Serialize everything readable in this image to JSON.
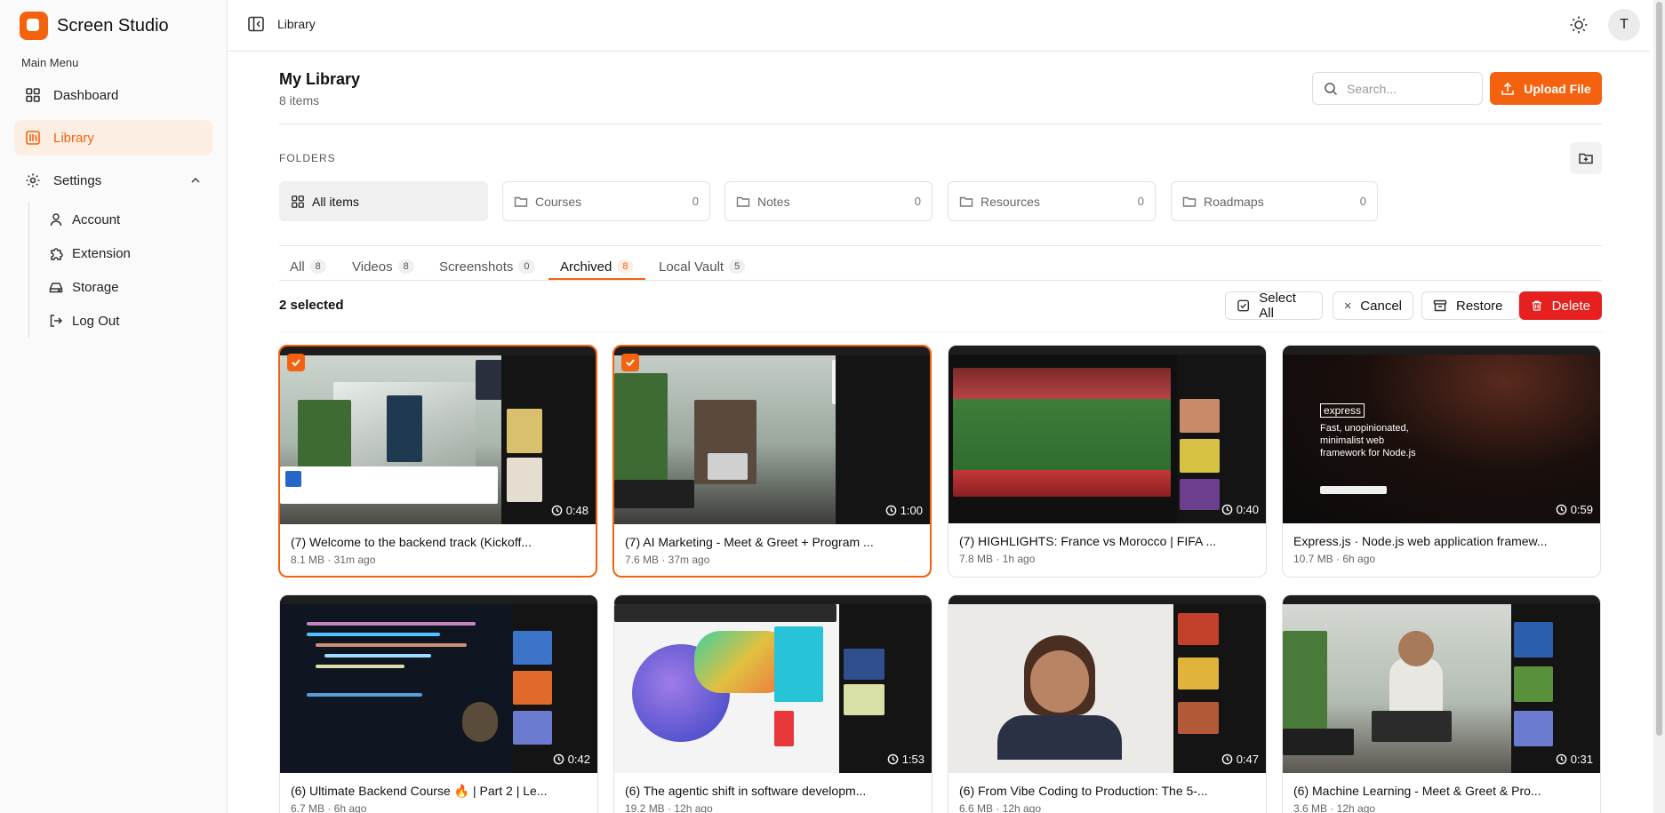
{
  "app": {
    "name": "Screen Studio"
  },
  "sidebar": {
    "menu_title": "Main Menu",
    "items": [
      {
        "label": "Dashboard",
        "icon": "grid-icon"
      },
      {
        "label": "Library",
        "icon": "library-icon",
        "active": true
      },
      {
        "label": "Settings",
        "icon": "gear-icon",
        "expanded": true
      }
    ],
    "sub_items": [
      {
        "label": "Account",
        "icon": "user-icon"
      },
      {
        "label": "Extension",
        "icon": "puzzle-icon"
      },
      {
        "label": "Storage",
        "icon": "drive-icon"
      },
      {
        "label": "Log Out",
        "icon": "logout-icon"
      }
    ]
  },
  "topbar": {
    "breadcrumb": "Library",
    "avatar_initial": "T"
  },
  "main": {
    "title": "My Library",
    "count": "8 items",
    "search": {
      "placeholder": "Search..."
    },
    "upload_label": "Upload File",
    "folders_title": "FOLDERS",
    "folders": [
      {
        "label": "All items",
        "count": ""
      },
      {
        "label": "Courses",
        "count": "0"
      },
      {
        "label": "Notes",
        "count": "0"
      },
      {
        "label": "Resources",
        "count": "0"
      },
      {
        "label": "Roadmaps",
        "count": "0"
      }
    ],
    "tabs": [
      {
        "label": "All",
        "count": "8"
      },
      {
        "label": "Videos",
        "count": "8"
      },
      {
        "label": "Screenshots",
        "count": "0"
      },
      {
        "label": "Archived",
        "count": "8",
        "active": true
      },
      {
        "label": "Local Vault",
        "count": "5"
      }
    ],
    "selection": {
      "text": "2 selected",
      "select_all": "Select All",
      "cancel": "Cancel",
      "restore": "Restore",
      "delete": "Delete"
    },
    "videos": [
      {
        "title": "(7) Welcome to the backend track (Kickoff...",
        "meta": "8.1 MB · 31m ago",
        "duration": "0:48",
        "selected": true
      },
      {
        "title": "(7) AI Marketing - Meet & Greet + Program ...",
        "meta": "7.6 MB · 37m ago",
        "duration": "1:00",
        "selected": true
      },
      {
        "title": "(7) HIGHLIGHTS: France vs Morocco | FIFA ...",
        "meta": "7.8 MB · 1h ago",
        "duration": "0:40",
        "selected": false
      },
      {
        "title": "Express.js · Node.js web application framew...",
        "meta": "10.7 MB · 6h ago",
        "duration": "0:59",
        "selected": false,
        "overlay_title": "express",
        "overlay_text": "Fast, unopinionated, minimalist web framework for Node.js"
      },
      {
        "title": "(6) Ultimate Backend Course 🔥 | Part 2 | Le...",
        "meta": "6.7 MB · 6h ago",
        "duration": "0:42",
        "selected": false
      },
      {
        "title": "(6) The agentic shift in software developm...",
        "meta": "19.2 MB · 12h ago",
        "duration": "1:53",
        "selected": false
      },
      {
        "title": "(6) From Vibe Coding to Production: The 5-...",
        "meta": "6.6 MB · 12h ago",
        "duration": "0:47",
        "selected": false
      },
      {
        "title": "(6) Machine Learning - Meet & Greet & Pro...",
        "meta": "3.6 MB · 12h ago",
        "duration": "0:31",
        "selected": false
      }
    ]
  },
  "colors": {
    "accent": "#f5620f",
    "danger": "#e5201f"
  }
}
